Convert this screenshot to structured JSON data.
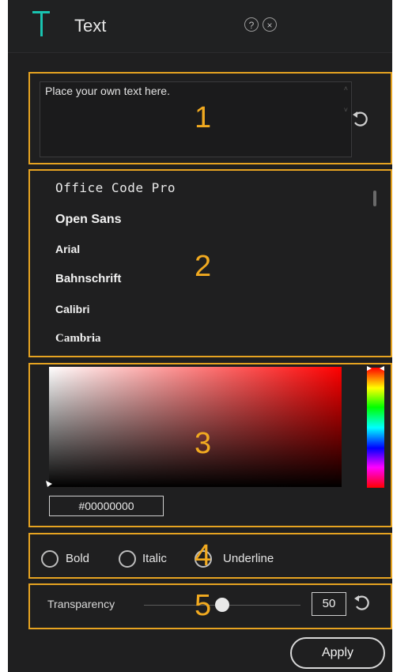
{
  "panel": {
    "title": "Text",
    "accent_color": "#19c3b0",
    "help_icon": "help-icon",
    "close_icon": "close-icon"
  },
  "text_section": {
    "value": "Place your own text here.",
    "callout": "1"
  },
  "fonts_section": {
    "callout": "2",
    "fonts": [
      "Office Code Pro",
      "Open Sans",
      "Arial",
      "Bahnschrift",
      "Calibri",
      "Cambria"
    ]
  },
  "color_section": {
    "callout": "3",
    "hex_value": "#00000000"
  },
  "style_section": {
    "callout": "4",
    "options": [
      "Bold",
      "Italic",
      "Underline"
    ]
  },
  "transparency_section": {
    "callout": "5",
    "label": "Transparency",
    "value": "50",
    "slider_fraction": 0.5
  },
  "apply_label": "Apply"
}
